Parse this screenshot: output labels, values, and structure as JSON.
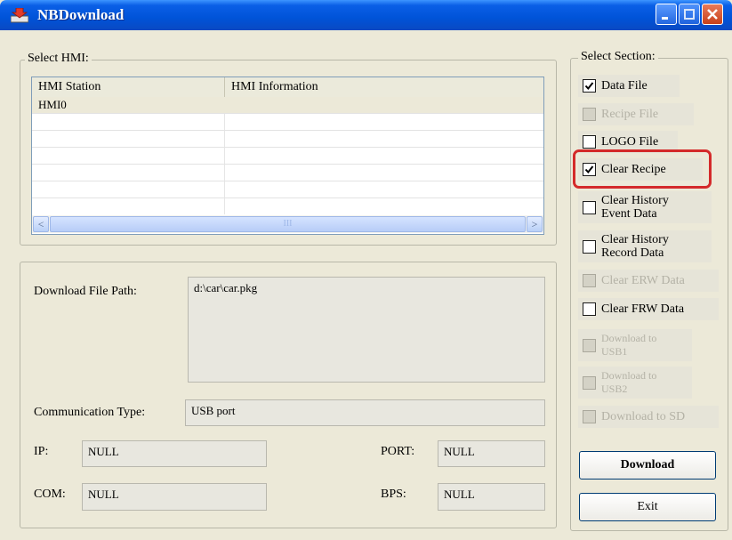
{
  "window": {
    "title": "NBDownload"
  },
  "select_hmi": {
    "label": "Select HMI:",
    "columns": [
      "HMI Station",
      "HMI Information"
    ],
    "rows": [
      {
        "station": "HMI0",
        "info": ""
      }
    ],
    "scroll_left": "<",
    "scroll_right": ">",
    "scroll_grip": "III"
  },
  "download": {
    "path_label": "Download File Path:",
    "path_value": "d:\\car\\car.pkg",
    "comm_label": "Communication Type:",
    "comm_value": "USB port",
    "ip_label": "IP:",
    "ip_value": "NULL",
    "port_label": "PORT:",
    "port_value": "NULL",
    "com_label": "COM:",
    "com_value": "NULL",
    "bps_label": "BPS:",
    "bps_value": "NULL"
  },
  "select_section": {
    "label": "Select Section:",
    "items": [
      {
        "label": "Data File",
        "checked": true,
        "enabled": true
      },
      {
        "label": "Recipe File",
        "checked": false,
        "enabled": false
      },
      {
        "label": "LOGO File",
        "checked": false,
        "enabled": true
      },
      {
        "label": "Clear Recipe",
        "checked": true,
        "enabled": true
      },
      {
        "label": "Clear History Event Data",
        "line1": "Clear History",
        "line2": "Event Data",
        "checked": false,
        "enabled": true
      },
      {
        "label": "Clear History Record Data",
        "line1": "Clear History",
        "line2": "Record Data",
        "checked": false,
        "enabled": true
      },
      {
        "label": "Clear ERW Data",
        "checked": false,
        "enabled": false
      },
      {
        "label": "Clear FRW Data",
        "checked": false,
        "enabled": true
      },
      {
        "label": "Download to USB1",
        "line1": "Download to",
        "line2": "USB1",
        "checked": false,
        "enabled": false
      },
      {
        "label": "Download to USB2",
        "line1": "Download to",
        "line2": "USB2",
        "checked": false,
        "enabled": false
      },
      {
        "label": "Download to SD",
        "checked": false,
        "enabled": false
      }
    ],
    "highlight_color": "#d42a2a"
  },
  "buttons": {
    "download": "Download",
    "exit": "Exit"
  },
  "colors": {
    "titlebar": "#0053d8",
    "face": "#ece9d8",
    "highlight": "#d42a2a"
  }
}
